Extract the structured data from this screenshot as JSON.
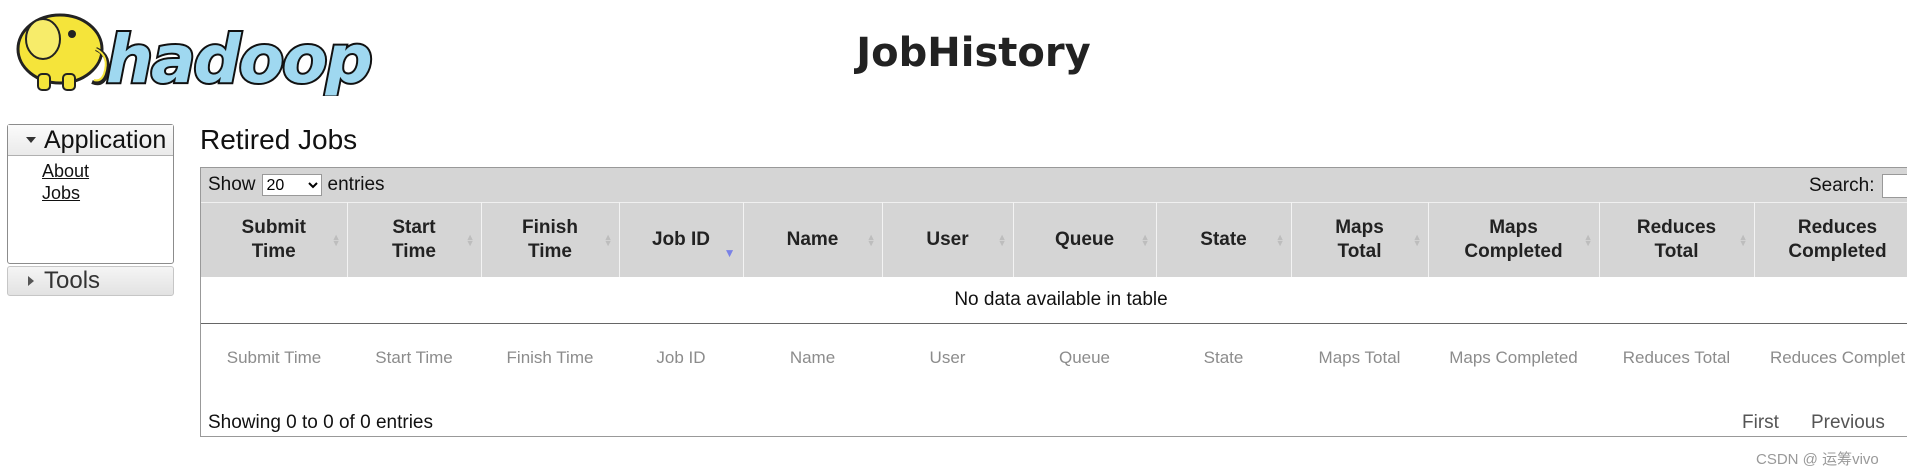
{
  "header": {
    "logo_text": "hadoop",
    "page_title": "JobHistory"
  },
  "sidebar": {
    "application": {
      "label": "Application",
      "links": [
        "About",
        "Jobs"
      ]
    },
    "tools": {
      "label": "Tools"
    }
  },
  "main": {
    "section_title": "Retired Jobs",
    "length_menu": {
      "show_label": "Show",
      "selected": "20",
      "entries_label": "entries"
    },
    "search_label": "Search:",
    "columns": [
      "Submit Time",
      "Start Time",
      "Finish Time",
      "Job ID",
      "Name",
      "User",
      "Queue",
      "State",
      "Maps Total",
      "Maps Completed",
      "Reduces Total",
      "Reduces Completed"
    ],
    "header_columns": [
      "Submit\nTime",
      "Start\nTime",
      "Finish\nTime",
      "Job ID",
      "Name",
      "User",
      "Queue",
      "State",
      "Maps\nTotal",
      "Maps\nCompleted",
      "Reduces\nTotal",
      "Reduces\nCompleted"
    ],
    "footer_columns": [
      "Submit Time",
      "Start Time",
      "Finish Time",
      "Job ID",
      "Name",
      "User",
      "Queue",
      "State",
      "Maps Total",
      "Maps Completed",
      "Reduces Total",
      "Reduces Complet"
    ],
    "sorted_column": "Job ID",
    "empty_message": "No data available in table",
    "info": "Showing 0 to 0 of 0 entries",
    "pagination": [
      "First",
      "Previous"
    ]
  },
  "watermark": "CSDN @⁦ 运筹vivo",
  "colors": {
    "toolbar_bg": "#d5d5d5",
    "sort_indicator": "#7a82e6",
    "logo_yellow": "#f5e43a",
    "logo_blue": "#9fd8f0"
  }
}
